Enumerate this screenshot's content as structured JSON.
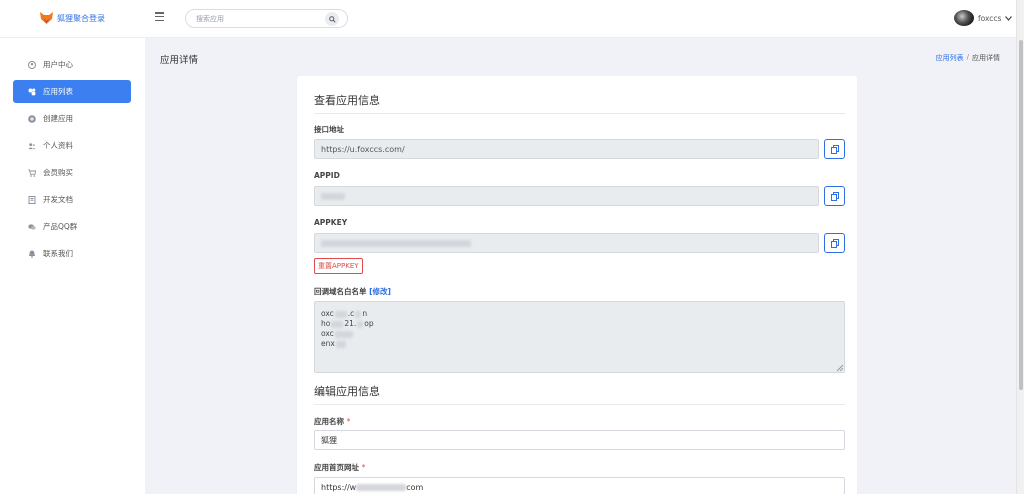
{
  "header": {
    "brand": "狐狸聚合登录",
    "search_placeholder": "搜索应用",
    "user_name": "foxccs"
  },
  "sidebar": {
    "items": [
      {
        "label": "用户中心",
        "icon": "user-circle-icon",
        "active": false
      },
      {
        "label": "应用列表",
        "icon": "apps-icon",
        "active": true
      },
      {
        "label": "创建应用",
        "icon": "plus-circle-icon",
        "active": false
      },
      {
        "label": "个人资料",
        "icon": "users-icon",
        "active": false
      },
      {
        "label": "会员购买",
        "icon": "cart-icon",
        "active": false
      },
      {
        "label": "开发文档",
        "icon": "book-icon",
        "active": false
      },
      {
        "label": "产品QQ群",
        "icon": "chat-icon",
        "active": false
      },
      {
        "label": "联系我们",
        "icon": "bell-icon",
        "active": false
      }
    ]
  },
  "page": {
    "title": "应用详情",
    "breadcrumb": {
      "link": "应用列表",
      "separator": "/",
      "current": "应用详情"
    }
  },
  "view_section": {
    "title": "查看应用信息",
    "api_label": "接口地址",
    "api_value": "https://u.foxccs.com/",
    "appid_label": "APPID",
    "appkey_label": "APPKEY",
    "reset_button": "重置APPKEY",
    "whitelist_label": "回调域名白名单",
    "whitelist_modify": "[修改]",
    "whitelist_lines": [
      "oxc",
      ".c",
      "n",
      "ho",
      "21.",
      "op",
      "oxc",
      "enx"
    ]
  },
  "edit_section": {
    "title": "编辑应用信息",
    "name_label": "应用名称",
    "required_mark": "*",
    "name_value": "狐狸",
    "homepage_label": "应用首页网址",
    "homepage_value": "https://w",
    "homepage_value_tail": "com"
  },
  "colors": {
    "accent": "#3b7ff0",
    "danger": "#e24b4b",
    "link": "#2f6fe4",
    "background": "#f0f2f7"
  }
}
